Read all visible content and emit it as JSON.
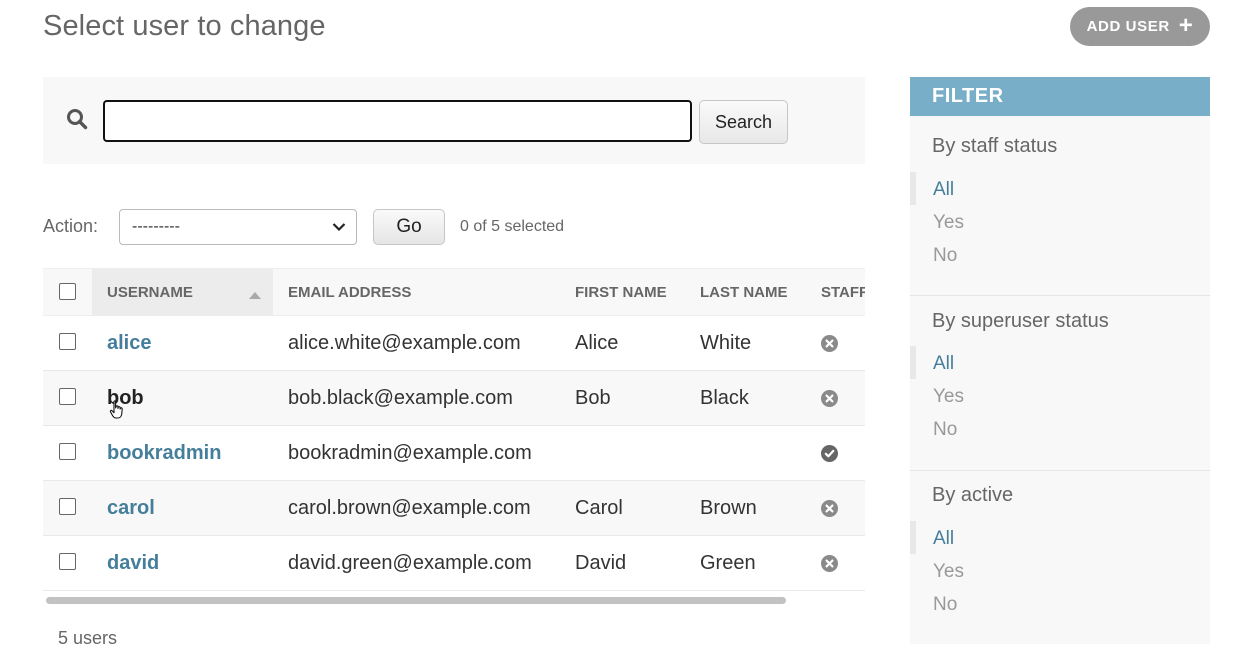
{
  "page": {
    "title": "Select user to change"
  },
  "header": {
    "add_user_label": "ADD USER",
    "add_icon": "+"
  },
  "search": {
    "value": "",
    "button_label": "Search"
  },
  "actions": {
    "label": "Action:",
    "selected_value": "---------",
    "go_label": "Go",
    "selected_count_text": "0 of 5 selected"
  },
  "table": {
    "columns": [
      "USERNAME",
      "EMAIL ADDRESS",
      "FIRST NAME",
      "LAST NAME",
      "STAFF"
    ],
    "sorted_column": "USERNAME",
    "rows": [
      {
        "username": "alice",
        "email": "alice.white@example.com",
        "first": "Alice",
        "last": "White",
        "staff": false
      },
      {
        "username": "bob",
        "email": "bob.black@example.com",
        "first": "Bob",
        "last": "Black",
        "staff": false
      },
      {
        "username": "bookradmin",
        "email": "bookradmin@example.com",
        "first": "",
        "last": "",
        "staff": true
      },
      {
        "username": "carol",
        "email": "carol.brown@example.com",
        "first": "Carol",
        "last": "Brown",
        "staff": false
      },
      {
        "username": "david",
        "email": "david.green@example.com",
        "first": "David",
        "last": "Green",
        "staff": false
      }
    ]
  },
  "footer": {
    "count_text": "5 users"
  },
  "filter": {
    "title": "FILTER",
    "groups": [
      {
        "title": "By staff status",
        "options": [
          "All",
          "Yes",
          "No"
        ],
        "selected": "All"
      },
      {
        "title": "By superuser status",
        "options": [
          "All",
          "Yes",
          "No"
        ],
        "selected": "All"
      },
      {
        "title": "By active",
        "options": [
          "All",
          "Yes",
          "No"
        ],
        "selected": "All"
      }
    ]
  },
  "colors": {
    "link": "#447e9b",
    "filter_header": "#79aec8",
    "add_button": "#999999",
    "status_icon": "#8a8a8a"
  },
  "icons": [
    "search-icon",
    "plus-icon",
    "chevron-down-icon",
    "sort-ascending-icon",
    "no-icon",
    "yes-icon",
    "hand-cursor-icon"
  ]
}
